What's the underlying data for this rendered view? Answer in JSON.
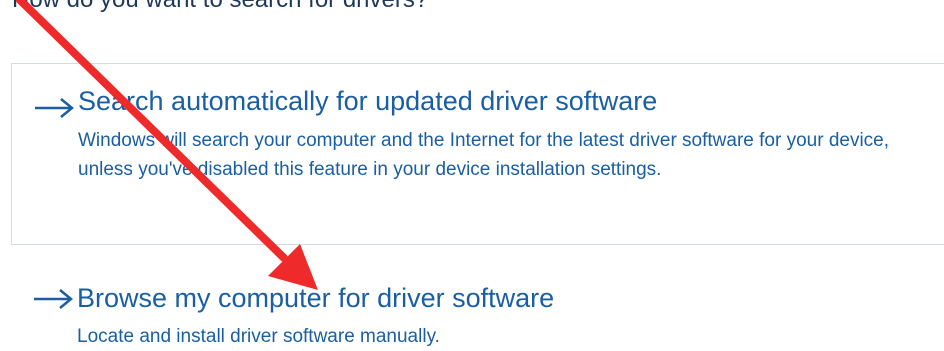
{
  "dialog": {
    "prompt": "How do you want to search for drivers?",
    "options": [
      {
        "title": "Search automatically for updated driver software",
        "description": "Windows will search your computer and the Internet for the latest driver software for your device, unless you've disabled this feature in your device installation settings.",
        "icon": "right-arrow-icon"
      },
      {
        "title": "Browse my computer for driver software",
        "description": "Locate and install driver software manually.",
        "icon": "right-arrow-icon"
      }
    ]
  },
  "annotation": {
    "type": "red-arrow",
    "color": "#ee2a2a",
    "points_to": "Browse my computer for driver software"
  },
  "colors": {
    "link_blue": "#1a5ea3",
    "border": "#d5dbe3",
    "background": "#ffffff"
  }
}
